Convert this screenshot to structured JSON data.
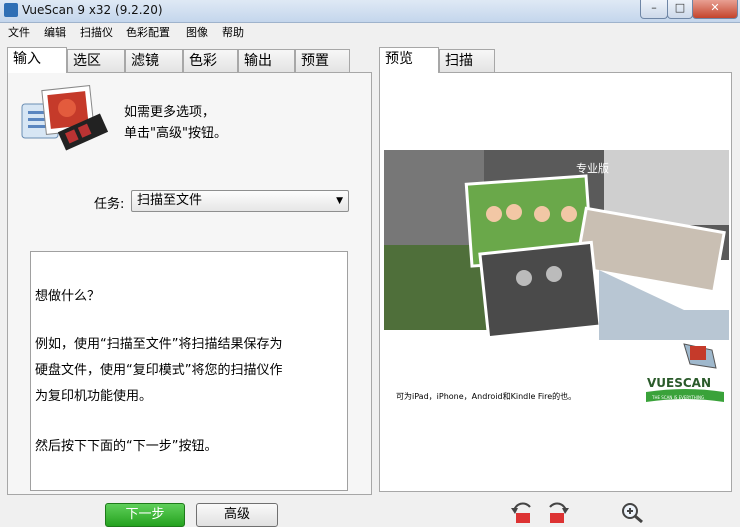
{
  "window": {
    "title": "VueScan 9 x32 (9.2.20)",
    "min_glyph": "–",
    "max_glyph": "□",
    "close_glyph": "✕"
  },
  "menu": [
    "文件",
    "编辑",
    "扫描仪",
    "色彩配置",
    "图像",
    "帮助"
  ],
  "left_tabs": [
    "输入",
    "选区",
    "滤镜",
    "色彩",
    "输出",
    "预置"
  ],
  "right_tabs": [
    "预览",
    "扫描"
  ],
  "hint": {
    "line1": "如需更多选项，",
    "line2": "单击\"高级\"按钮。"
  },
  "task": {
    "label": "任务:",
    "value": "扫描至文件"
  },
  "description": [
    "想做什么？",
    "例如，使用“扫描至文件”将扫描结果保存为",
    "硬盘文件，使用“复印模式”将您的扫描仪作",
    "为复印机功能使用。",
    "然后按下下面的“下一步”按钮。"
  ],
  "buttons": {
    "next": "下一步",
    "advanced": "高级"
  },
  "preview": {
    "badge": "专业版",
    "caption": "可为iPad，iPhone，Android和Kindle Fire的也。",
    "logo_text": "VUESCAN",
    "logo_sub": "THE SCAN IS EVERYTHING"
  },
  "icons": [
    "rotate-left-icon",
    "rotate-right-icon",
    "zoom-icon"
  ],
  "colors": {
    "accent_green": "#25a21f",
    "title_bar": "#c4d6ec",
    "logo_green": "#3aa23a"
  }
}
